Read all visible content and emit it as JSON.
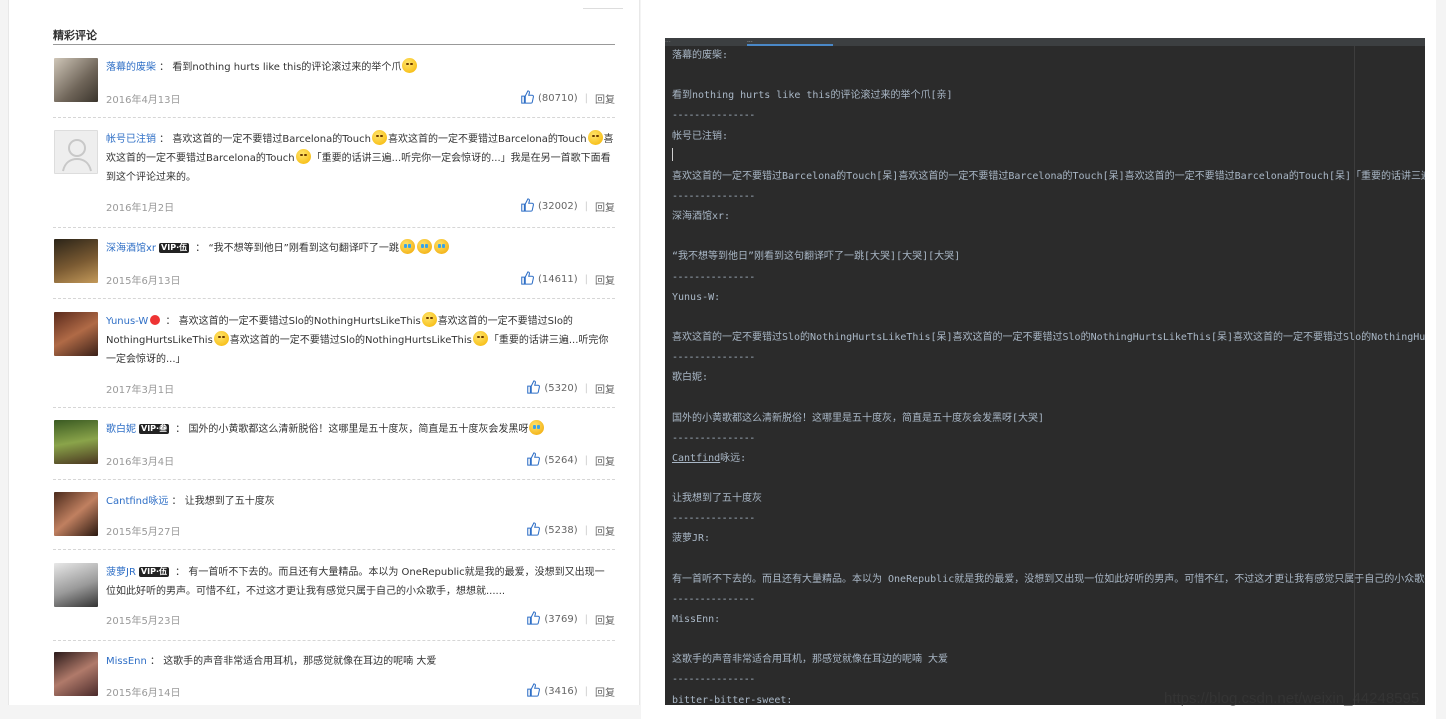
{
  "section_title": "精彩评论",
  "comments": [
    {
      "user": "落幕的废柴",
      "badge": "",
      "text": "看到nothing hurts like this的评论滚过来的举个爪",
      "emoji_tail": [
        "smile"
      ],
      "date": "2016年4月13日",
      "likes": "(80710)",
      "reply": "回复"
    },
    {
      "user": "帐号已注销",
      "badge": "",
      "text": "喜欢这首的一定不要错过Barcelona的Touch",
      "text2": "喜欢这首的一定不要错过Barcelona的Touch",
      "text3": "喜欢这首的一定不要错过Barcelona的Touch",
      "text4": "「重要的话讲三遍...听完你一定会惊讶的...」我是在另一首歌下面看到这个评论过来的。",
      "date": "2016年1月2日",
      "likes": "(32002)",
      "reply": "回复"
    },
    {
      "user": "深海酒馆xr",
      "badge": "VIP·伍",
      "text": "“我不想等到他日”刚看到这句翻译吓了一跳",
      "date": "2015年6月13日",
      "likes": "(14611)",
      "reply": "回复"
    },
    {
      "user": "Yunus-W",
      "badge": "",
      "text": "喜欢这首的一定不要错过Slo的NothingHurtsLikeThis",
      "text2": "喜欢这首的一定不要错过Slo的NothingHurtsLikeThis",
      "text3": "喜欢这首的一定不要错过Slo的NothingHurtsLikeThis",
      "text4": "「重要的话讲三遍...听完你一定会惊讶的...」",
      "date": "2017年3月1日",
      "likes": "(5320)",
      "reply": "回复"
    },
    {
      "user": "歌白妮",
      "badge": "VIP·叁",
      "text": "国外的小黄歌都这么清新脱俗！这哪里是五十度灰，简直是五十度灰会发黑呀",
      "date": "2016年3月4日",
      "likes": "(5264)",
      "reply": "回复"
    },
    {
      "user": "Cantfind咏远",
      "badge": "",
      "text": "让我想到了五十度灰",
      "date": "2015年5月27日",
      "likes": "(5238)",
      "reply": "回复"
    },
    {
      "user": "菠萝JR",
      "badge": "VIP·伍",
      "text": "有一首听不下去的。而且还有大量精品。本以为 OneRepublic就是我的最爱，没想到又出现一位如此好听的男声。可惜不红，不过这才更让我有感觉只属于自己的小众歌手，想想就......",
      "date": "2015年5月23日",
      "likes": "(3769)",
      "reply": "回复"
    },
    {
      "user": "MissEnn",
      "badge": "",
      "text": "这歌手的声音非常适合用耳机，那感觉就像在耳边的呢喃 大爱",
      "date": "2015年6月14日",
      "likes": "(3416)",
      "reply": "回复"
    }
  ],
  "editor": {
    "tab1": "...",
    "tab2": "...",
    "lines": [
      "落幕的废柴:",
      "",
      "看到nothing hurts like this的评论滚过来的举个爪[亲]",
      "---------------",
      "帐号已注销:",
      "",
      "喜欢这首的一定不要错过Barcelona的Touch[呆]喜欢这首的一定不要错过Barcelona的Touch[呆]喜欢这首的一定不要错过Barcelona的Touch[呆]「重要的话讲三遍…听完你一定会",
      "---------------",
      "深海酒馆xr:",
      "",
      "“我不想等到他日”刚看到这句翻译吓了一跳[大哭][大哭][大哭]",
      "---------------",
      "Yunus-W:",
      "",
      "喜欢这首的一定不要错过Slo的NothingHurtsLikeThis[呆]喜欢这首的一定不要错过Slo的NothingHurtsLikeThis[呆]喜欢这首的一定不要错过Slo的NothingHurtsLikeThi",
      "---------------",
      "歌白妮:",
      "",
      "国外的小黄歌都这么清新脱俗！这哪里是五十度灰，简直是五十度灰会发黑呀[大哭]",
      "---------------",
      "Cantfind咏远:",
      "",
      "让我想到了五十度灰",
      "---------------",
      "菠萝JR:",
      "",
      "有一首听不下去的。而且还有大量精品。本以为 OneRepublic就是我的最爱，没想到又出现一位如此好听的男声。可惜不红，不过这才更让我有感觉只属于自己的小众歌手，想想就....",
      "---------------",
      "MissEnn:",
      "",
      "这歌手的声音非常适合用耳机，那感觉就像在耳边的呢喃 大爱",
      "---------------",
      "bitter-bitter-sweet:"
    ]
  },
  "watermark": "https://blog.csdn.net/weixin_44248595"
}
